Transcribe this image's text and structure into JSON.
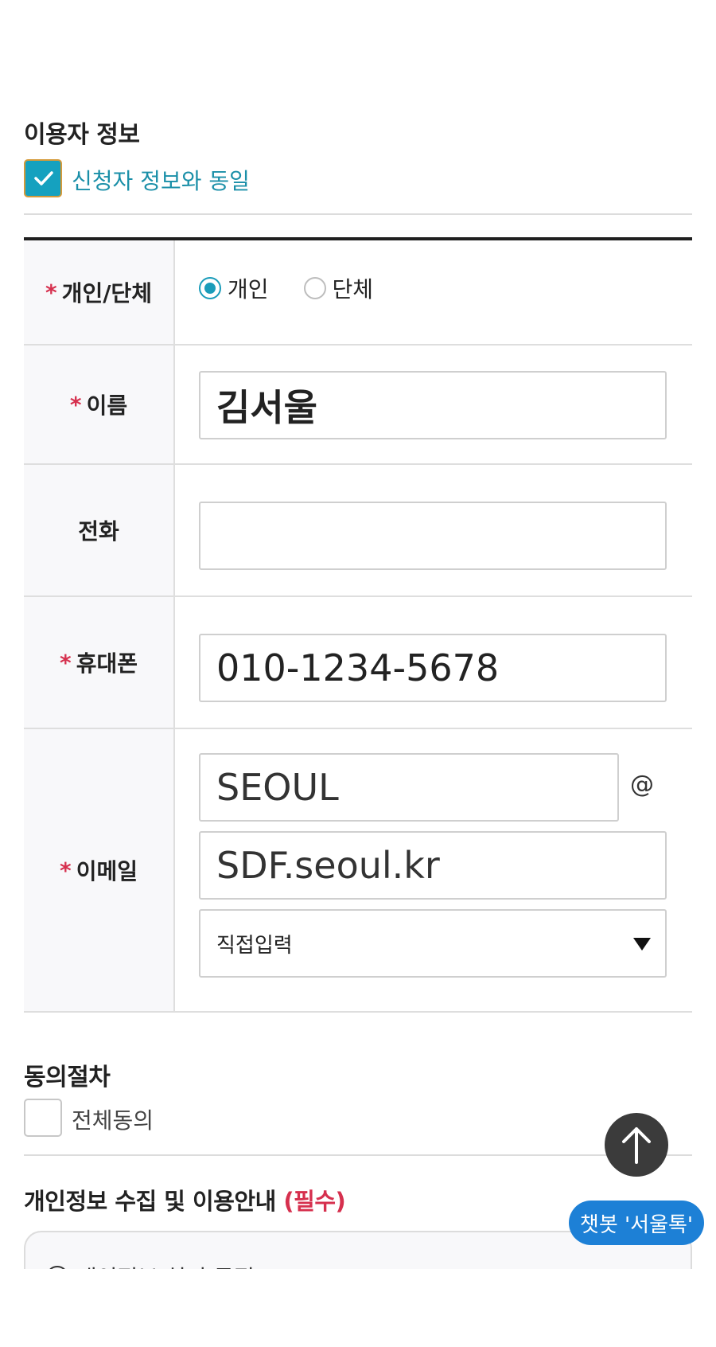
{
  "user_info": {
    "title": "이용자 정보",
    "same_as_applicant_label": "신청자 정보와 동일",
    "same_as_applicant_checked": true
  },
  "form": {
    "type": {
      "label": "개인/단체",
      "required_mark": "*",
      "options": [
        "개인",
        "단체"
      ],
      "selected": "개인"
    },
    "name": {
      "label": "이름",
      "required_mark": "*",
      "value": "김서울"
    },
    "phone": {
      "label": "전화",
      "value": ""
    },
    "mobile": {
      "label": "휴대폰",
      "required_mark": "*",
      "value": "010-1234-5678"
    },
    "email": {
      "label": "이메일",
      "required_mark": "*",
      "local_part": "SEOUL",
      "at": "@",
      "domain": "SDF.seoul.kr",
      "domain_select": "직접입력"
    }
  },
  "consent": {
    "title": "동의절차",
    "all_agree_label": "전체동의",
    "privacy_title": "개인정보 수집 및 이용안내",
    "privacy_required": "(필수)",
    "privacy_first_item": "개인정보 처리 목적"
  },
  "floating": {
    "chatbot_label": "챗봇 '서울톡'"
  },
  "colors": {
    "accent": "#15a1bf",
    "required": "#d6304e",
    "chatbot": "#1d80d6"
  }
}
